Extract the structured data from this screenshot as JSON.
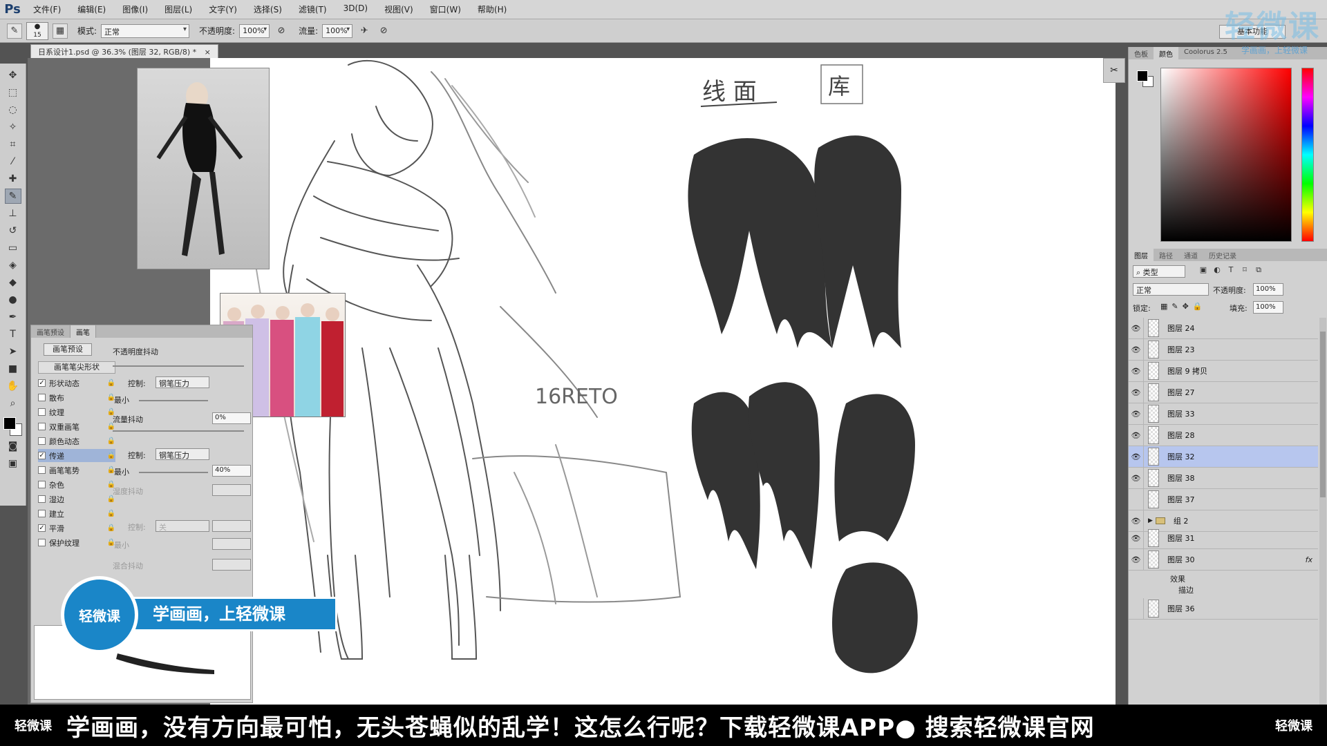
{
  "app": {
    "logo": "Ps",
    "menu": [
      "文件(F)",
      "编辑(E)",
      "图像(I)",
      "图层(L)",
      "文字(Y)",
      "选择(S)",
      "滤镜(T)",
      "3D(D)",
      "视图(V)",
      "窗口(W)",
      "帮助(H)"
    ],
    "workspace": "基本功能"
  },
  "options_bar": {
    "brush_size": "15",
    "mode_label": "模式:",
    "mode_value": "正常",
    "opacity_label": "不透明度:",
    "opacity_value": "100%",
    "flow_label": "流量:",
    "flow_value": "100%"
  },
  "document": {
    "tab_title": "日系设计1.psd @ 36.3% (图层 32, RGB/8) *",
    "close": "×"
  },
  "canvas_notes": {
    "label_1": "线 面",
    "label_2": "库",
    "label_3": "16RETO"
  },
  "brush_panel": {
    "tabs": [
      "画笔预设",
      "画笔"
    ],
    "presets_button": "画笔预设",
    "tip_shape": "画笔笔尖形状",
    "options": [
      {
        "label": "形状动态",
        "checked": "✓",
        "selected": false
      },
      {
        "label": "散布",
        "checked": "",
        "selected": false
      },
      {
        "label": "纹理",
        "checked": "",
        "selected": false
      },
      {
        "label": "双重画笔",
        "checked": "",
        "selected": false
      },
      {
        "label": "颜色动态",
        "checked": "",
        "selected": false
      },
      {
        "label": "传递",
        "checked": "✓",
        "selected": true
      },
      {
        "label": "画笔笔势",
        "checked": "",
        "selected": false
      },
      {
        "label": "杂色",
        "checked": "",
        "selected": false
      },
      {
        "label": "湿边",
        "checked": "",
        "selected": false
      },
      {
        "label": "建立",
        "checked": "",
        "selected": false
      },
      {
        "label": "平滑",
        "checked": "✓",
        "selected": false
      },
      {
        "label": "保护纹理",
        "checked": "",
        "selected": false
      }
    ],
    "opacity_jitter": "不透明度抖动",
    "control_label": "控制:",
    "control_value": "钢笔压力",
    "min_label": "最小",
    "flow_jitter": "流量抖动",
    "flow_jitter_value": "0%",
    "control2_value": "钢笔压力",
    "min2_value": "40%",
    "wet_jitter": "湿度抖动",
    "control3_value": "关",
    "mix_jitter": "混合抖动"
  },
  "color_panel": {
    "tabs": [
      "色板",
      "颜色",
      "Coolorus 2.5"
    ]
  },
  "layers_panel": {
    "tabs": [
      "图层",
      "路径",
      "通道",
      "历史记录"
    ],
    "filter": "类型",
    "blend_mode": "正常",
    "opacity_label": "不透明度:",
    "opacity_value": "100%",
    "lock_label": "锁定:",
    "fill_label": "填充:",
    "fill_value": "100%",
    "layers": [
      {
        "name": "图层 24",
        "visible": true,
        "selected": false,
        "type": "layer"
      },
      {
        "name": "图层 23",
        "visible": true,
        "selected": false,
        "type": "layer"
      },
      {
        "name": "图层 9 拷贝",
        "visible": true,
        "selected": false,
        "type": "layer"
      },
      {
        "name": "图层 27",
        "visible": true,
        "selected": false,
        "type": "layer"
      },
      {
        "name": "图层 33",
        "visible": true,
        "selected": false,
        "type": "layer"
      },
      {
        "name": "图层 28",
        "visible": true,
        "selected": false,
        "type": "layer"
      },
      {
        "name": "图层 32",
        "visible": true,
        "selected": true,
        "type": "layer"
      },
      {
        "name": "图层 38",
        "visible": true,
        "selected": false,
        "type": "layer"
      },
      {
        "name": "图层 37",
        "visible": false,
        "selected": false,
        "type": "layer"
      },
      {
        "name": "组 2",
        "visible": true,
        "selected": false,
        "type": "group"
      },
      {
        "name": "图层 31",
        "visible": true,
        "selected": false,
        "type": "layer"
      },
      {
        "name": "图层 30",
        "visible": true,
        "selected": false,
        "type": "layer",
        "fx": "fx"
      },
      {
        "name": "图层 36",
        "visible": false,
        "selected": false,
        "type": "layer"
      }
    ],
    "effects_label": "效果",
    "stroke_label": "描边"
  },
  "watermark": {
    "title": "轻微课",
    "subtitle": "学画画，上轻微课"
  },
  "promo": {
    "logo": "轻微课",
    "slogan": "学画画，上轻微课"
  },
  "ticker": {
    "logo": "轻微课",
    "text": "学画画，没有方向最可怕，无头苍蝇似的乱学！这怎么行呢？下载轻微课APP● 搜索轻微课官网"
  }
}
